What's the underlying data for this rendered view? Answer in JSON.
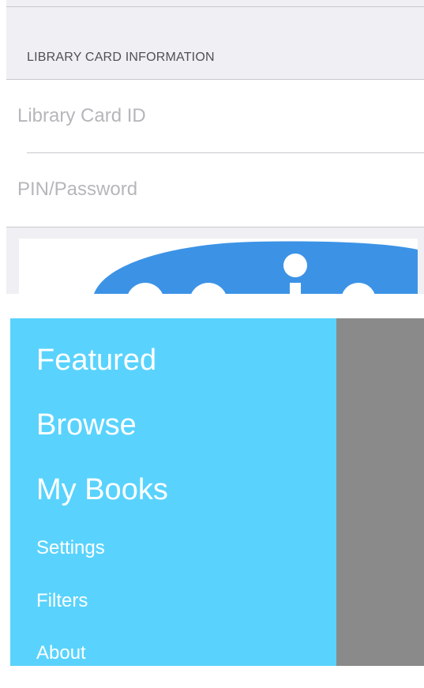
{
  "login": {
    "section_header": "LIBRARY CARD INFORMATION",
    "card_id_placeholder": "Library Card ID",
    "pin_placeholder": "PIN/Password"
  },
  "menu": {
    "items": [
      {
        "label": "Featured"
      },
      {
        "label": "Browse"
      },
      {
        "label": "My Books"
      },
      {
        "label": "Settings"
      },
      {
        "label": "Filters"
      },
      {
        "label": "About"
      }
    ]
  },
  "colors": {
    "menu_background": "#59d3fd",
    "overlay": "#8a8a8a",
    "logo_blue": "#3c93e6",
    "form_background": "#efeff4"
  },
  "icons": {
    "logo": "library-app-logo-icon"
  }
}
